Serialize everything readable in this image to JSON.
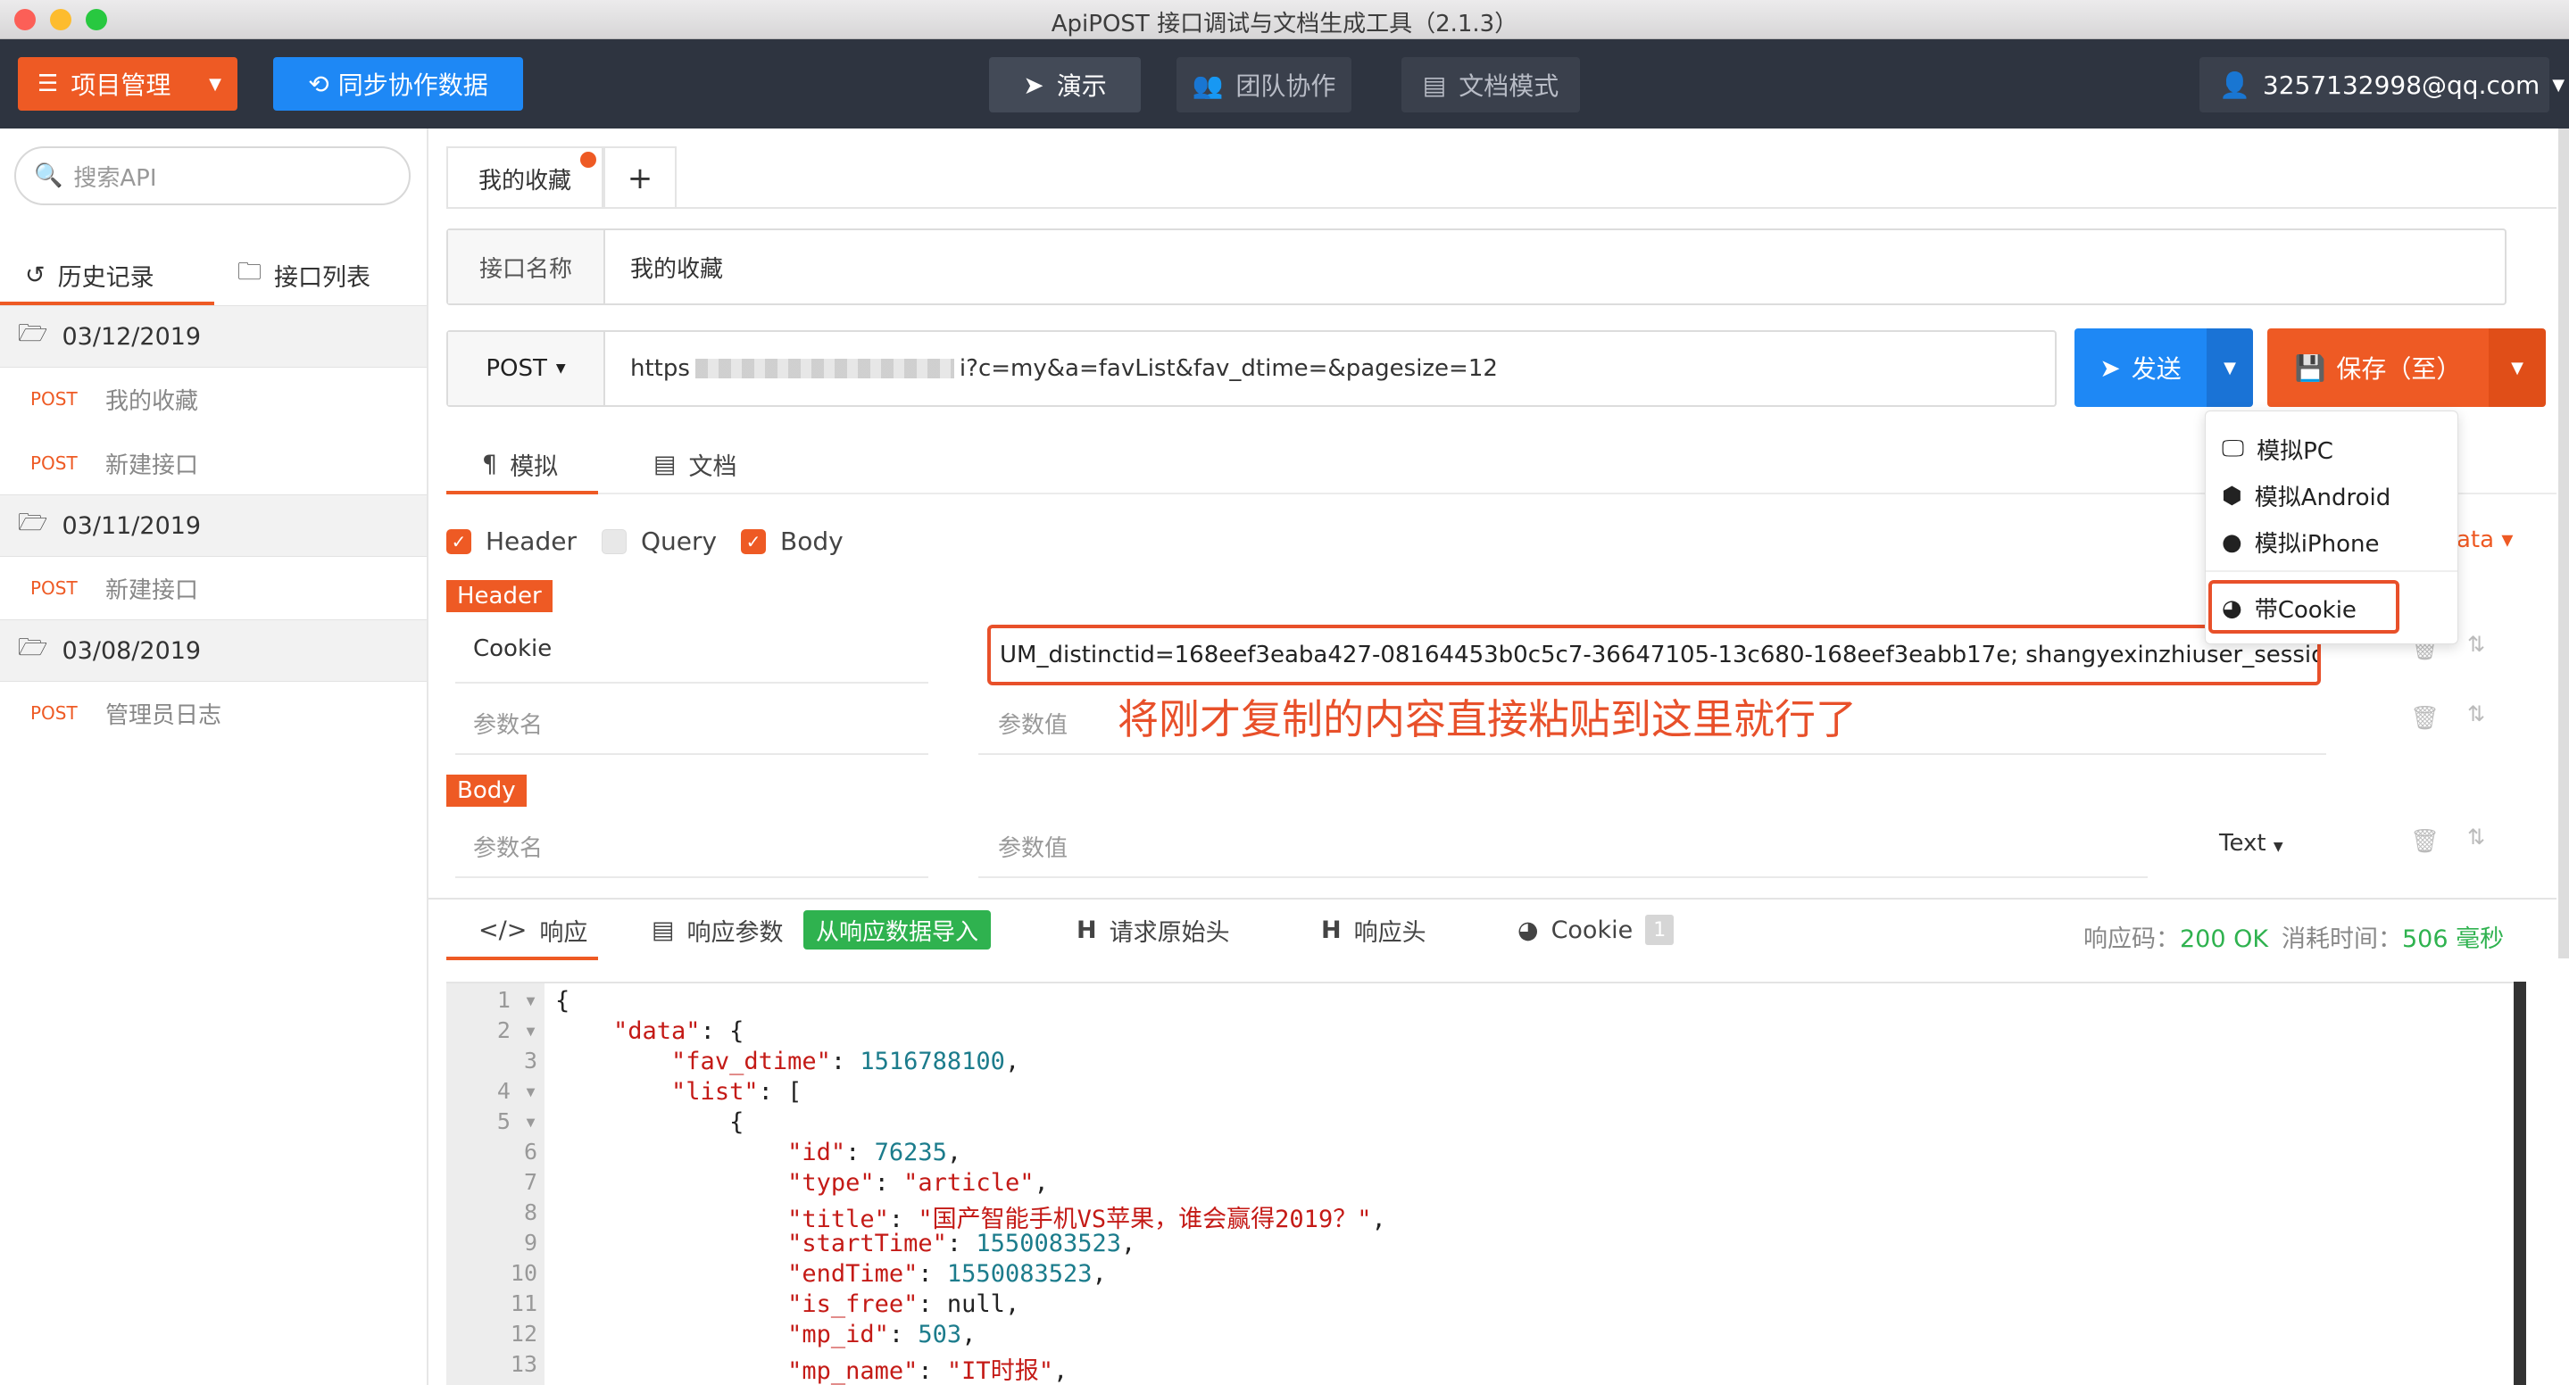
{
  "window": {
    "title": "ApiPOST 接口调试与文档生成工具（2.1.3）"
  },
  "toolbar": {
    "project_btn": "项目管理",
    "sync_btn": "同步协作数据",
    "nav": [
      "演示",
      "团队协作",
      "文档模式"
    ],
    "user": "3257132998@qq.com"
  },
  "sidebar": {
    "search_placeholder": "搜索API",
    "tabs": [
      "历史记录",
      "接口列表"
    ],
    "groups": [
      {
        "date": "03/12/2019",
        "items": [
          {
            "method": "POST",
            "name": "我的收藏"
          },
          {
            "method": "POST",
            "name": "新建接口"
          }
        ]
      },
      {
        "date": "03/11/2019",
        "items": [
          {
            "method": "POST",
            "name": "新建接口"
          }
        ]
      },
      {
        "date": "03/08/2019",
        "items": [
          {
            "method": "POST",
            "name": "管理员日志"
          }
        ]
      }
    ]
  },
  "main": {
    "tab_label": "我的收藏",
    "tab_add": "+",
    "name_label": "接口名称",
    "name_value": "我的收藏",
    "method": "POST",
    "url_prefix": "https",
    "url_suffix": "i?c=my&a=favList&fav_dtime=&pagesize=12",
    "send_btn": "发送",
    "save_btn": "保存（至）",
    "subtabs": [
      "模拟",
      "文档"
    ],
    "checks": [
      {
        "label": "Header",
        "on": true
      },
      {
        "label": "Query",
        "on": false
      },
      {
        "label": "Body",
        "on": true
      }
    ],
    "header_section": "Header",
    "body_section": "Body",
    "cookie_name": "Cookie",
    "cookie_value": "UM_distinctid=168eef3eaba427-08164453b0c5c7-36647105-13c680-168eef3eabb17e; shangyexinzhiuser_session_id=a",
    "param_name_placeholder": "参数名",
    "param_value_placeholder": "参数值",
    "body_type": "Text",
    "data_hint": "ata",
    "annotation": "将刚才复制的内容直接粘贴到这里就行了"
  },
  "menu": {
    "items": [
      "模拟PC",
      "模拟Android",
      "模拟iPhone",
      "带Cookie"
    ]
  },
  "response": {
    "tabs": [
      "响应",
      "响应参数",
      "请求原始头",
      "响应头",
      "Cookie"
    ],
    "import_btn": "从响应数据导入",
    "cookie_count": "1",
    "status_label": "响应码：",
    "status_value": "200 OK",
    "time_label": "消耗时间：",
    "time_value": "506 毫秒"
  },
  "code_lines": [
    "{",
    "    \"data\": {",
    "        \"fav_dtime\": 1516788100,",
    "        \"list\": [",
    "            {",
    "                \"id\": 76235,",
    "                \"type\": \"article\",",
    "                \"title\": \"国产智能手机VS苹果，谁会赢得2019？\",",
    "                \"startTime\": 1550083523,",
    "                \"endTime\": 1550083523,",
    "                \"is_free\": null,",
    "                \"mp_id\": 503,",
    "                \"mp_name\": \"IT时报\","
  ],
  "colors": {
    "accent": "#ee5a24",
    "blue": "#1e88f5",
    "green": "#2fb24f",
    "dark": "#2e3440"
  }
}
